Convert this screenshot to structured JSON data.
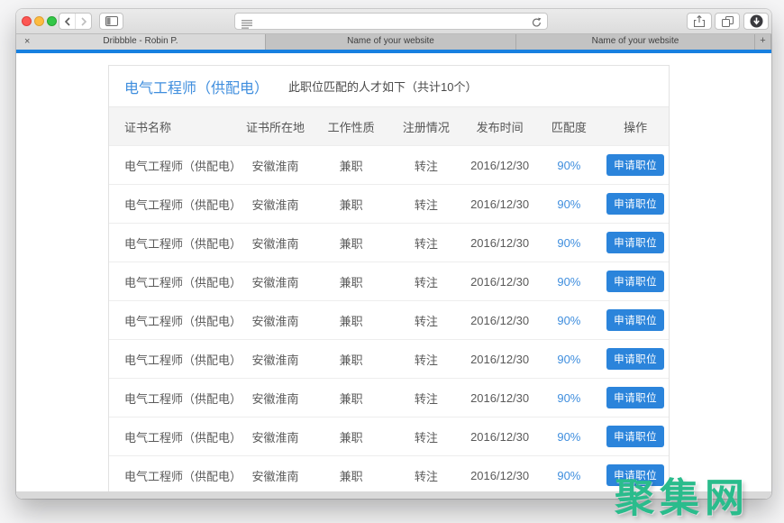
{
  "browser": {
    "toolbar": {
      "address_value": ""
    },
    "tabs": [
      {
        "label": "Dribbble - Robin P.",
        "active": true
      },
      {
        "label": "Name of your website",
        "active": false
      },
      {
        "label": "Name of your website",
        "active": false
      }
    ],
    "tab_close_glyph": "×",
    "new_tab_glyph": "+"
  },
  "page": {
    "accent_color": "#1780e0",
    "title": "电气工程师（供配电）",
    "subtitle": "此职位匹配的人才如下（共计10个）",
    "table": {
      "columns": [
        "证书名称",
        "证书所在地",
        "工作性质",
        "注册情况",
        "发布时间",
        "匹配度",
        "操作"
      ],
      "action_label": "申请职位",
      "match_color": "#3f8ede",
      "button_color": "#2b84db",
      "rows": [
        {
          "name": "电气工程师（供配电）",
          "location": "安徽淮南",
          "nature": "兼职",
          "registration": "转注",
          "date": "2016/12/30",
          "match": "90%"
        },
        {
          "name": "电气工程师（供配电）",
          "location": "安徽淮南",
          "nature": "兼职",
          "registration": "转注",
          "date": "2016/12/30",
          "match": "90%"
        },
        {
          "name": "电气工程师（供配电）",
          "location": "安徽淮南",
          "nature": "兼职",
          "registration": "转注",
          "date": "2016/12/30",
          "match": "90%"
        },
        {
          "name": "电气工程师（供配电）",
          "location": "安徽淮南",
          "nature": "兼职",
          "registration": "转注",
          "date": "2016/12/30",
          "match": "90%"
        },
        {
          "name": "电气工程师（供配电）",
          "location": "安徽淮南",
          "nature": "兼职",
          "registration": "转注",
          "date": "2016/12/30",
          "match": "90%"
        },
        {
          "name": "电气工程师（供配电）",
          "location": "安徽淮南",
          "nature": "兼职",
          "registration": "转注",
          "date": "2016/12/30",
          "match": "90%"
        },
        {
          "name": "电气工程师（供配电）",
          "location": "安徽淮南",
          "nature": "兼职",
          "registration": "转注",
          "date": "2016/12/30",
          "match": "90%"
        },
        {
          "name": "电气工程师（供配电）",
          "location": "安徽淮南",
          "nature": "兼职",
          "registration": "转注",
          "date": "2016/12/30",
          "match": "90%"
        },
        {
          "name": "电气工程师（供配电）",
          "location": "安徽淮南",
          "nature": "兼职",
          "registration": "转注",
          "date": "2016/12/30",
          "match": "90%"
        }
      ]
    }
  },
  "watermark": {
    "text": "聚集网",
    "color": "#2abc8c"
  },
  "icons": {
    "back": "chevron-left",
    "forward": "chevron-right",
    "sidebar": "split-panel",
    "reader": "reader-lines",
    "refresh": "circular-arrow",
    "share": "box-with-up-arrow",
    "tab_overview": "stacked-squares",
    "downloads": "dark-circle-down-arrow",
    "close_tab": "×",
    "new_tab": "+"
  }
}
